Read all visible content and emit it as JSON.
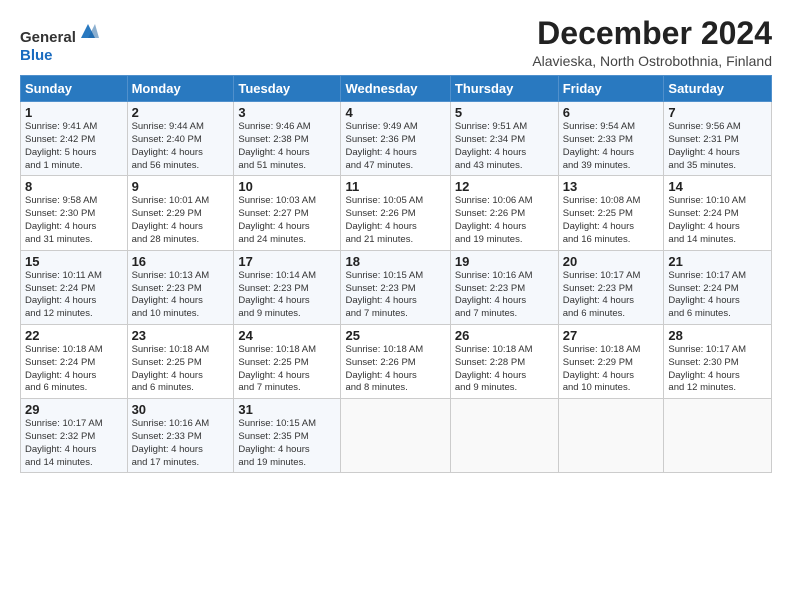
{
  "header": {
    "logo_general": "General",
    "logo_blue": "Blue",
    "title": "December 2024",
    "subtitle": "Alavieska, North Ostrobothnia, Finland"
  },
  "weekdays": [
    "Sunday",
    "Monday",
    "Tuesday",
    "Wednesday",
    "Thursday",
    "Friday",
    "Saturday"
  ],
  "weeks": [
    [
      {
        "day": "1",
        "info": "Sunrise: 9:41 AM\nSunset: 2:42 PM\nDaylight: 5 hours\nand 1 minute."
      },
      {
        "day": "2",
        "info": "Sunrise: 9:44 AM\nSunset: 2:40 PM\nDaylight: 4 hours\nand 56 minutes."
      },
      {
        "day": "3",
        "info": "Sunrise: 9:46 AM\nSunset: 2:38 PM\nDaylight: 4 hours\nand 51 minutes."
      },
      {
        "day": "4",
        "info": "Sunrise: 9:49 AM\nSunset: 2:36 PM\nDaylight: 4 hours\nand 47 minutes."
      },
      {
        "day": "5",
        "info": "Sunrise: 9:51 AM\nSunset: 2:34 PM\nDaylight: 4 hours\nand 43 minutes."
      },
      {
        "day": "6",
        "info": "Sunrise: 9:54 AM\nSunset: 2:33 PM\nDaylight: 4 hours\nand 39 minutes."
      },
      {
        "day": "7",
        "info": "Sunrise: 9:56 AM\nSunset: 2:31 PM\nDaylight: 4 hours\nand 35 minutes."
      }
    ],
    [
      {
        "day": "8",
        "info": "Sunrise: 9:58 AM\nSunset: 2:30 PM\nDaylight: 4 hours\nand 31 minutes."
      },
      {
        "day": "9",
        "info": "Sunrise: 10:01 AM\nSunset: 2:29 PM\nDaylight: 4 hours\nand 28 minutes."
      },
      {
        "day": "10",
        "info": "Sunrise: 10:03 AM\nSunset: 2:27 PM\nDaylight: 4 hours\nand 24 minutes."
      },
      {
        "day": "11",
        "info": "Sunrise: 10:05 AM\nSunset: 2:26 PM\nDaylight: 4 hours\nand 21 minutes."
      },
      {
        "day": "12",
        "info": "Sunrise: 10:06 AM\nSunset: 2:26 PM\nDaylight: 4 hours\nand 19 minutes."
      },
      {
        "day": "13",
        "info": "Sunrise: 10:08 AM\nSunset: 2:25 PM\nDaylight: 4 hours\nand 16 minutes."
      },
      {
        "day": "14",
        "info": "Sunrise: 10:10 AM\nSunset: 2:24 PM\nDaylight: 4 hours\nand 14 minutes."
      }
    ],
    [
      {
        "day": "15",
        "info": "Sunrise: 10:11 AM\nSunset: 2:24 PM\nDaylight: 4 hours\nand 12 minutes."
      },
      {
        "day": "16",
        "info": "Sunrise: 10:13 AM\nSunset: 2:23 PM\nDaylight: 4 hours\nand 10 minutes."
      },
      {
        "day": "17",
        "info": "Sunrise: 10:14 AM\nSunset: 2:23 PM\nDaylight: 4 hours\nand 9 minutes."
      },
      {
        "day": "18",
        "info": "Sunrise: 10:15 AM\nSunset: 2:23 PM\nDaylight: 4 hours\nand 7 minutes."
      },
      {
        "day": "19",
        "info": "Sunrise: 10:16 AM\nSunset: 2:23 PM\nDaylight: 4 hours\nand 7 minutes."
      },
      {
        "day": "20",
        "info": "Sunrise: 10:17 AM\nSunset: 2:23 PM\nDaylight: 4 hours\nand 6 minutes."
      },
      {
        "day": "21",
        "info": "Sunrise: 10:17 AM\nSunset: 2:24 PM\nDaylight: 4 hours\nand 6 minutes."
      }
    ],
    [
      {
        "day": "22",
        "info": "Sunrise: 10:18 AM\nSunset: 2:24 PM\nDaylight: 4 hours\nand 6 minutes."
      },
      {
        "day": "23",
        "info": "Sunrise: 10:18 AM\nSunset: 2:25 PM\nDaylight: 4 hours\nand 6 minutes."
      },
      {
        "day": "24",
        "info": "Sunrise: 10:18 AM\nSunset: 2:25 PM\nDaylight: 4 hours\nand 7 minutes."
      },
      {
        "day": "25",
        "info": "Sunrise: 10:18 AM\nSunset: 2:26 PM\nDaylight: 4 hours\nand 8 minutes."
      },
      {
        "day": "26",
        "info": "Sunrise: 10:18 AM\nSunset: 2:28 PM\nDaylight: 4 hours\nand 9 minutes."
      },
      {
        "day": "27",
        "info": "Sunrise: 10:18 AM\nSunset: 2:29 PM\nDaylight: 4 hours\nand 10 minutes."
      },
      {
        "day": "28",
        "info": "Sunrise: 10:17 AM\nSunset: 2:30 PM\nDaylight: 4 hours\nand 12 minutes."
      }
    ],
    [
      {
        "day": "29",
        "info": "Sunrise: 10:17 AM\nSunset: 2:32 PM\nDaylight: 4 hours\nand 14 minutes."
      },
      {
        "day": "30",
        "info": "Sunrise: 10:16 AM\nSunset: 2:33 PM\nDaylight: 4 hours\nand 17 minutes."
      },
      {
        "day": "31",
        "info": "Sunrise: 10:15 AM\nSunset: 2:35 PM\nDaylight: 4 hours\nand 19 minutes."
      },
      {
        "day": "",
        "info": ""
      },
      {
        "day": "",
        "info": ""
      },
      {
        "day": "",
        "info": ""
      },
      {
        "day": "",
        "info": ""
      }
    ]
  ]
}
